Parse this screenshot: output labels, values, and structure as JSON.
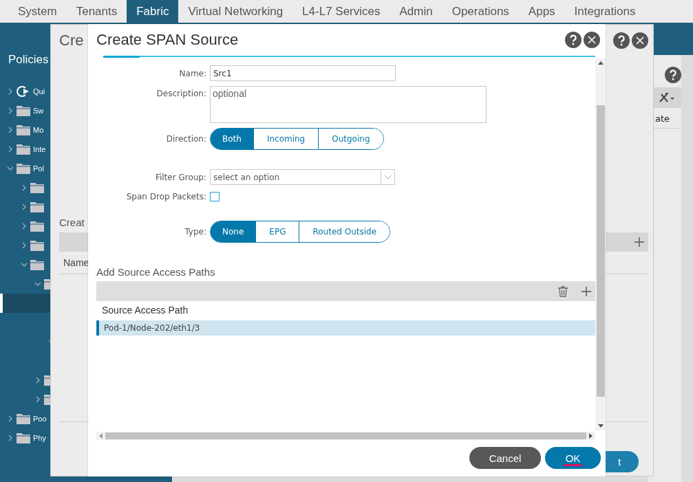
{
  "nav": {
    "tabs": [
      {
        "label": "System",
        "selected": false
      },
      {
        "label": "Tenants",
        "selected": false
      },
      {
        "label": "Fabric",
        "selected": true
      },
      {
        "label": "Virtual Networking",
        "selected": false
      },
      {
        "label": "L4-L7 Services",
        "selected": false
      },
      {
        "label": "Admin",
        "selected": false
      },
      {
        "label": "Operations",
        "selected": false
      },
      {
        "label": "Apps",
        "selected": false
      },
      {
        "label": "Integrations",
        "selected": false
      }
    ]
  },
  "sidebar": {
    "title": "Policies",
    "tree": [
      {
        "kind": "quickstart",
        "label": "Qui",
        "expanded": false,
        "selected": false
      },
      {
        "kind": "folder",
        "label": "Sw",
        "expanded": false,
        "selected": false
      },
      {
        "kind": "folder",
        "label": "Mo",
        "expanded": false,
        "selected": false
      },
      {
        "kind": "folder",
        "label": "Inte",
        "expanded": false,
        "selected": false
      },
      {
        "kind": "folder",
        "label": "Pol",
        "expanded": true,
        "selected": false,
        "children": [
          {
            "kind": "folder",
            "expanded": false,
            "selected": false
          },
          {
            "kind": "folder",
            "expanded": false,
            "selected": false
          },
          {
            "kind": "folder",
            "expanded": false,
            "selected": false
          },
          {
            "kind": "folder",
            "expanded": false,
            "selected": false
          },
          {
            "kind": "folder",
            "expanded": true,
            "selected": false,
            "children": [
              {
                "kind": "folder",
                "expanded": true,
                "selected": false,
                "children": [
                  {
                    "selected": true
                  },
                  {
                    "selected": false
                  },
                  {
                    "expanded": true,
                    "selected": false,
                    "children": [
                      {
                        "selected": false
                      }
                    ]
                  }
                ]
              },
              {
                "kind": "folder",
                "expanded": false,
                "selected": false
              },
              {
                "kind": "folder",
                "expanded": false,
                "selected": false
              }
            ]
          }
        ]
      },
      {
        "kind": "folder",
        "label": "Poo",
        "expanded": false,
        "selected": false
      },
      {
        "kind": "folder",
        "label": "Phy",
        "expanded": false,
        "selected": false
      }
    ]
  },
  "page": {
    "column_fragment": "ate"
  },
  "background_dialog": {
    "title": "Cre",
    "section_title": "Creat",
    "column": "Name",
    "button": "t"
  },
  "dialog": {
    "title": "Create SPAN Source",
    "fields": [
      {
        "kind": "text",
        "label": "Name:",
        "value": "Src1"
      },
      {
        "kind": "textarea",
        "label": "Description:",
        "placeholder": "optional"
      },
      {
        "kind": "segmented",
        "label": "Direction:",
        "options": [
          {
            "label": "Both",
            "selected": true
          },
          {
            "label": "Incoming",
            "selected": false
          },
          {
            "label": "Outgoing",
            "selected": false
          }
        ]
      },
      {
        "kind": "select",
        "label": "Filter Group:",
        "placeholder": "select an option"
      },
      {
        "kind": "checkbox",
        "label": "Span Drop Packets:",
        "checked": false
      },
      {
        "kind": "segmented",
        "label": "Type:",
        "options": [
          {
            "label": "None",
            "selected": true
          },
          {
            "label": "EPG",
            "selected": false
          },
          {
            "label": "Routed Outside",
            "selected": false
          }
        ]
      }
    ],
    "paths": {
      "title": "Add Source Access Paths",
      "columns": [
        "Source Access Path"
      ],
      "rows": [
        {
          "cells": [
            "Pod-1/Node-202/eth1/3"
          ],
          "selected": true
        }
      ]
    },
    "buttons": [
      {
        "kind": "secondary",
        "label": "Cancel",
        "focused": false
      },
      {
        "kind": "primary",
        "label": "OK",
        "focused": true
      }
    ]
  }
}
